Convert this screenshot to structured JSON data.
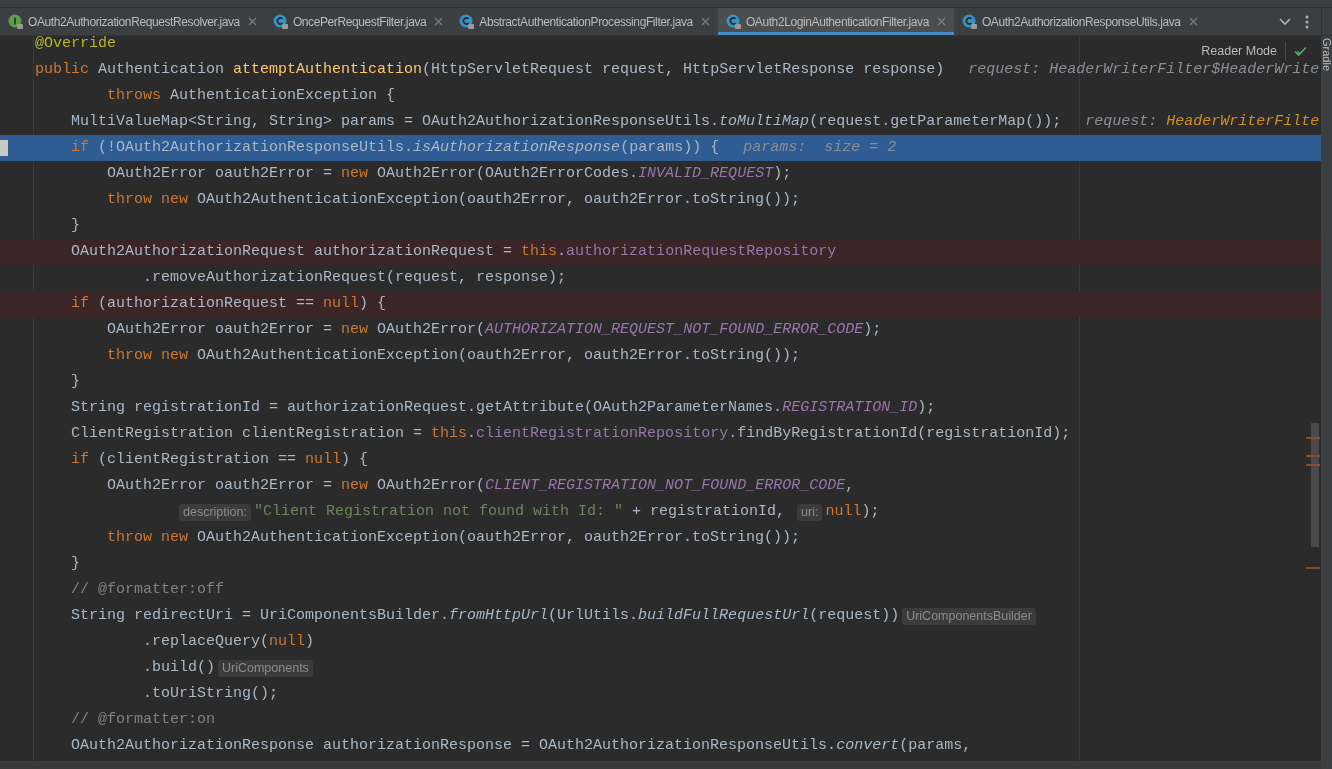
{
  "tabs": [
    {
      "label": "OAuth2AuthorizationRequestResolver.java",
      "kind": "interface",
      "selected": false
    },
    {
      "label": "OncePerRequestFilter.java",
      "kind": "class",
      "selected": false
    },
    {
      "label": "AbstractAuthenticationProcessingFilter.java",
      "kind": "class",
      "selected": false
    },
    {
      "label": "OAuth2LoginAuthenticationFilter.java",
      "kind": "class",
      "selected": true
    },
    {
      "label": "OAuth2AuthorizationResponseUtils.java",
      "kind": "class",
      "selected": false
    }
  ],
  "reader_mode": "Reader Mode",
  "side_panel": "Gradle",
  "code_lines": [
    {
      "segments": [
        {
          "kind": "annotation",
          "text": "@Override"
        }
      ]
    },
    {
      "segments": [
        {
          "kind": "keyword",
          "text": "public "
        },
        {
          "kind": "plain",
          "text": "Authentication "
        },
        {
          "kind": "method",
          "text": "attemptAuthentication"
        },
        {
          "kind": "plain",
          "text": "(HttpServletRequest request, HttpServletResponse response)"
        },
        {
          "kind": "debug",
          "text": "request: HeaderWriterFilter$HeaderWrite"
        }
      ]
    },
    {
      "segments": [
        {
          "kind": "keyword",
          "text": "        throws "
        },
        {
          "kind": "plain",
          "text": "AuthenticationException {"
        }
      ]
    },
    {
      "segments": [
        {
          "kind": "plain",
          "text": "    MultiValueMap<String, String> params = OAuth2AuthorizationResponseUtils."
        },
        {
          "kind": "static",
          "text": "toMultiMap"
        },
        {
          "kind": "plain",
          "text": "(request.getParameterMap());"
        },
        {
          "kind": "debug",
          "text": "request: "
        },
        {
          "kind": "debug_value",
          "text": "HeaderWriterFilte"
        }
      ]
    },
    {
      "current": true,
      "segments": [
        {
          "kind": "keyword",
          "text": "    if "
        },
        {
          "kind": "plain",
          "text": "(!OAuth2AuthorizationResponseUtils."
        },
        {
          "kind": "static",
          "text": "isAuthorizationResponse"
        },
        {
          "kind": "plain",
          "text": "(params)) {"
        },
        {
          "kind": "debug",
          "text": "params:  size = 2"
        }
      ]
    },
    {
      "segments": [
        {
          "kind": "plain",
          "text": "        OAuth2Error oauth2Error = "
        },
        {
          "kind": "keyword",
          "text": "new "
        },
        {
          "kind": "plain",
          "text": "OAuth2Error(OAuth2ErrorCodes."
        },
        {
          "kind": "constant",
          "text": "INVALID_REQUEST"
        },
        {
          "kind": "plain",
          "text": ");"
        }
      ]
    },
    {
      "segments": [
        {
          "kind": "keyword",
          "text": "        throw new "
        },
        {
          "kind": "plain",
          "text": "OAuth2AuthenticationException(oauth2Error, oauth2Error.toString());"
        }
      ]
    },
    {
      "segments": [
        {
          "kind": "plain",
          "text": "    }"
        }
      ]
    },
    {
      "breakpoint": true,
      "segments": [
        {
          "kind": "plain",
          "text": "    OAuth2AuthorizationRequest authorizationRequest = "
        },
        {
          "kind": "keyword",
          "text": "this"
        },
        {
          "kind": "plain",
          "text": "."
        },
        {
          "kind": "field",
          "text": "authorizationRequestRepository"
        }
      ]
    },
    {
      "segments": [
        {
          "kind": "plain",
          "text": "            .removeAuthorizationRequest(request, response);"
        }
      ]
    },
    {
      "breakpoint": true,
      "segments": [
        {
          "kind": "keyword",
          "text": "    if "
        },
        {
          "kind": "plain",
          "text": "(authorizationRequest == "
        },
        {
          "kind": "keyword",
          "text": "null"
        },
        {
          "kind": "plain",
          "text": ") {"
        }
      ]
    },
    {
      "segments": [
        {
          "kind": "plain",
          "text": "        OAuth2Error oauth2Error = "
        },
        {
          "kind": "keyword",
          "text": "new "
        },
        {
          "kind": "plain",
          "text": "OAuth2Error("
        },
        {
          "kind": "constant",
          "text": "AUTHORIZATION_REQUEST_NOT_FOUND_ERROR_CODE"
        },
        {
          "kind": "plain",
          "text": ");"
        }
      ]
    },
    {
      "segments": [
        {
          "kind": "keyword",
          "text": "        throw new "
        },
        {
          "kind": "plain",
          "text": "OAuth2AuthenticationException(oauth2Error, oauth2Error.toString());"
        }
      ]
    },
    {
      "segments": [
        {
          "kind": "plain",
          "text": "    }"
        }
      ]
    },
    {
      "segments": [
        {
          "kind": "plain",
          "text": "    String registrationId = authorizationRequest.getAttribute(OAuth2ParameterNames."
        },
        {
          "kind": "constant",
          "text": "REGISTRATION_ID"
        },
        {
          "kind": "plain",
          "text": ");"
        }
      ]
    },
    {
      "segments": [
        {
          "kind": "plain",
          "text": "    ClientRegistration clientRegistration = "
        },
        {
          "kind": "keyword",
          "text": "this"
        },
        {
          "kind": "plain",
          "text": "."
        },
        {
          "kind": "field",
          "text": "clientRegistrationRepository"
        },
        {
          "kind": "plain",
          "text": ".findByRegistrationId(registrationId);"
        }
      ]
    },
    {
      "segments": [
        {
          "kind": "keyword",
          "text": "    if "
        },
        {
          "kind": "plain",
          "text": "(clientRegistration == "
        },
        {
          "kind": "keyword",
          "text": "null"
        },
        {
          "kind": "plain",
          "text": ") {"
        }
      ]
    },
    {
      "segments": [
        {
          "kind": "plain",
          "text": "        OAuth2Error oauth2Error = "
        },
        {
          "kind": "keyword",
          "text": "new "
        },
        {
          "kind": "plain",
          "text": "OAuth2Error("
        },
        {
          "kind": "constant",
          "text": "CLIENT_REGISTRATION_NOT_FOUND_ERROR_CODE"
        },
        {
          "kind": "plain",
          "text": ","
        }
      ]
    },
    {
      "segments": [
        {
          "kind": "hint",
          "text": "                description:"
        },
        {
          "kind": "string",
          "text": "\"Client Registration not found with Id: \""
        },
        {
          "kind": "plain",
          "text": " + registrationId, "
        },
        {
          "kind": "hint",
          "text": "uri:"
        },
        {
          "kind": "keyword",
          "text": "null"
        },
        {
          "kind": "plain",
          "text": ");"
        }
      ]
    },
    {
      "segments": [
        {
          "kind": "keyword",
          "text": "        throw new "
        },
        {
          "kind": "plain",
          "text": "OAuth2AuthenticationException(oauth2Error, oauth2Error.toString());"
        }
      ]
    },
    {
      "segments": [
        {
          "kind": "plain",
          "text": "    }"
        }
      ]
    },
    {
      "segments": [
        {
          "kind": "comment",
          "text": "    // @formatter:off"
        }
      ]
    },
    {
      "segments": [
        {
          "kind": "plain",
          "text": "    String redirectUri = UriComponentsBuilder."
        },
        {
          "kind": "static",
          "text": "fromHttpUrl"
        },
        {
          "kind": "plain",
          "text": "(UrlUtils."
        },
        {
          "kind": "static",
          "text": "buildFullRequestUrl"
        },
        {
          "kind": "plain",
          "text": "(request))"
        },
        {
          "kind": "hint",
          "text": "UriComponentsBuilder"
        }
      ]
    },
    {
      "segments": [
        {
          "kind": "plain",
          "text": "            .replaceQuery("
        },
        {
          "kind": "keyword",
          "text": "null"
        },
        {
          "kind": "plain",
          "text": ")"
        }
      ]
    },
    {
      "segments": [
        {
          "kind": "plain",
          "text": "            .build()"
        },
        {
          "kind": "hint",
          "text": "UriComponents"
        }
      ]
    },
    {
      "segments": [
        {
          "kind": "plain",
          "text": "            .toUriString();"
        }
      ]
    },
    {
      "segments": [
        {
          "kind": "comment",
          "text": "    // @formatter:on"
        }
      ]
    },
    {
      "segments": [
        {
          "kind": "plain",
          "text": "    OAuth2AuthorizationResponse authorizationResponse = OAuth2AuthorizationResponseUtils."
        },
        {
          "kind": "static",
          "text": "convert"
        },
        {
          "kind": "plain",
          "text": "(params,"
        }
      ]
    }
  ]
}
